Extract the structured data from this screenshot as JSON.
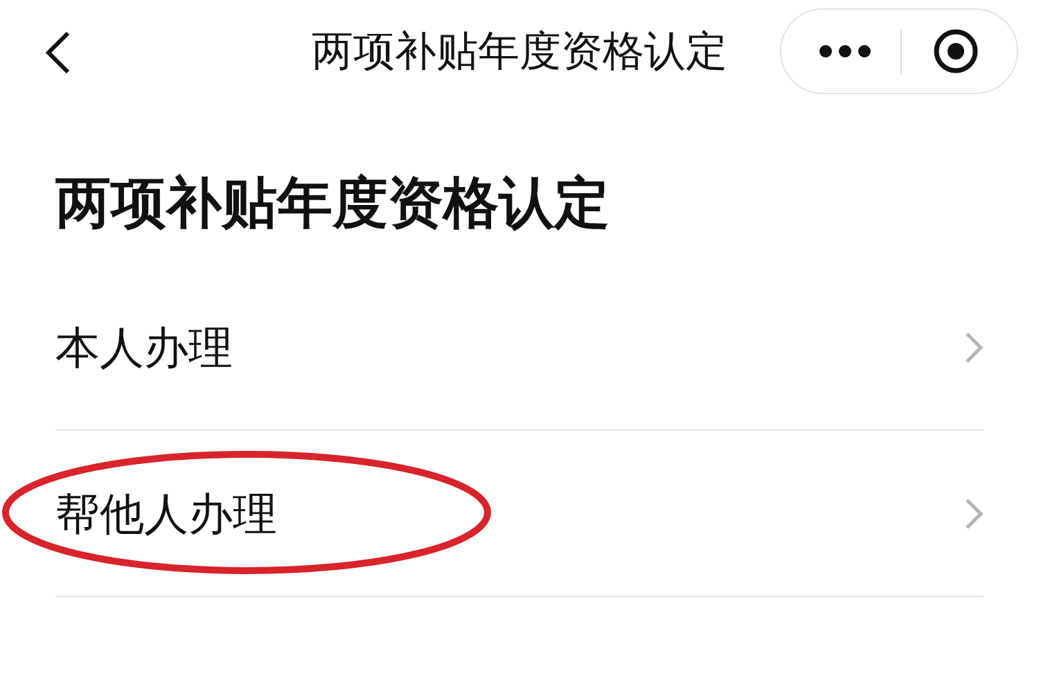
{
  "nav": {
    "title": "两项补贴年度资格认定"
  },
  "heading": "两项补贴年度资格认定",
  "items": [
    {
      "label": "本人办理",
      "circled": false
    },
    {
      "label": "帮他人办理",
      "circled": true
    }
  ]
}
